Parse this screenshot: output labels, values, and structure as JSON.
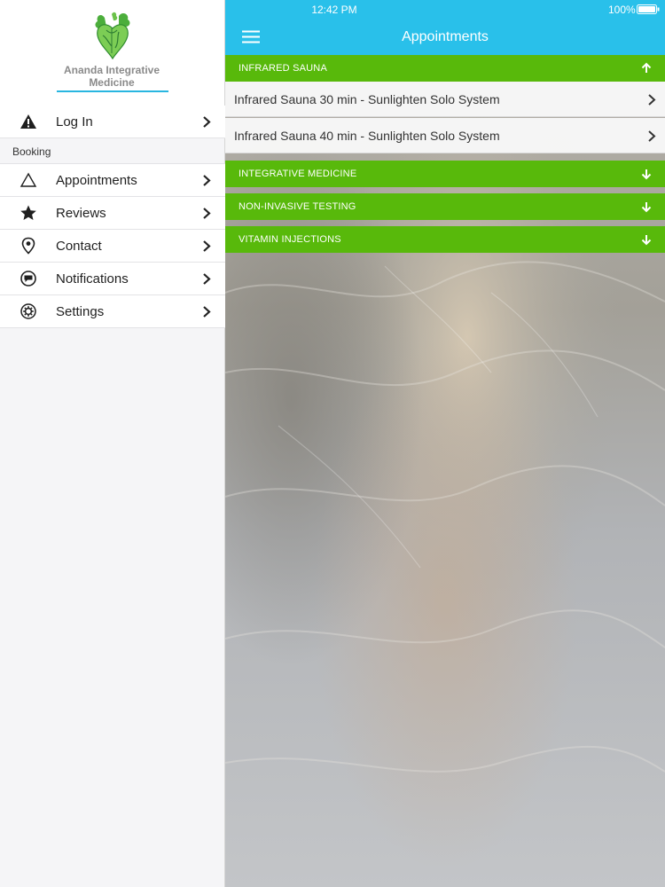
{
  "sidebar": {
    "brand": {
      "name_line1": "Ananda Integrative",
      "name_line2": "Medicine"
    },
    "login": {
      "label": "Log In",
      "icon": "warning-icon"
    },
    "section_label": "Booking",
    "items": [
      {
        "label": "Appointments",
        "icon": "triangle-icon"
      },
      {
        "label": "Reviews",
        "icon": "star-icon"
      },
      {
        "label": "Contact",
        "icon": "location-pin-icon"
      },
      {
        "label": "Notifications",
        "icon": "chat-bubble-icon"
      },
      {
        "label": "Settings",
        "icon": "gear-icon"
      }
    ]
  },
  "status_bar": {
    "time": "12:42 PM",
    "battery": "100%"
  },
  "navbar": {
    "title": "Appointments"
  },
  "categories": [
    {
      "label": "INFRARED SAUNA",
      "expanded": true,
      "items": [
        "Infrared Sauna 30 min - Sunlighten Solo System",
        "Infrared Sauna 40 min - Sunlighten Solo System"
      ]
    },
    {
      "label": "INTEGRATIVE MEDICINE",
      "expanded": false
    },
    {
      "label": "NON-INVASIVE TESTING",
      "expanded": false
    },
    {
      "label": "VITAMIN INJECTIONS",
      "expanded": false
    }
  ],
  "colors": {
    "navbar": "#29c0ea",
    "category": "#58b90b",
    "accent_line": "#29b6e0"
  }
}
